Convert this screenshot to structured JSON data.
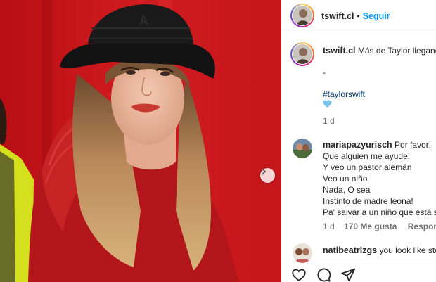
{
  "post": {
    "username": "tswift.cl",
    "follow_label": "Seguir",
    "caption_text": "Más de Taylor llegando",
    "caption_separator": "-",
    "hashtag": "#taylorswift",
    "caption_time": "1 d",
    "heart_color": "#7dc4ec"
  },
  "comments": [
    {
      "username": "mariapazyurisch",
      "lines": [
        "Por favor!",
        "Que alguien me ayude!",
        "Y veo un pastor alemán",
        "Veo un niño",
        "Nada, O sea",
        "Instinto de madre leona!",
        "Pa' salvar a un niño que está s"
      ],
      "time": "1 d",
      "likes": "170 Me gusta",
      "reply_label": "Responder"
    },
    {
      "username": "natibeatrizgs",
      "text": "you look like ste"
    }
  ],
  "actions": {
    "like_icon": "heart-icon",
    "comment_icon": "comment-icon",
    "share_icon": "share-icon"
  },
  "colors": {
    "background_red": "#c4171b",
    "link_blue": "#0095f6",
    "hashtag_blue": "#00376b",
    "muted_text": "#737373"
  }
}
